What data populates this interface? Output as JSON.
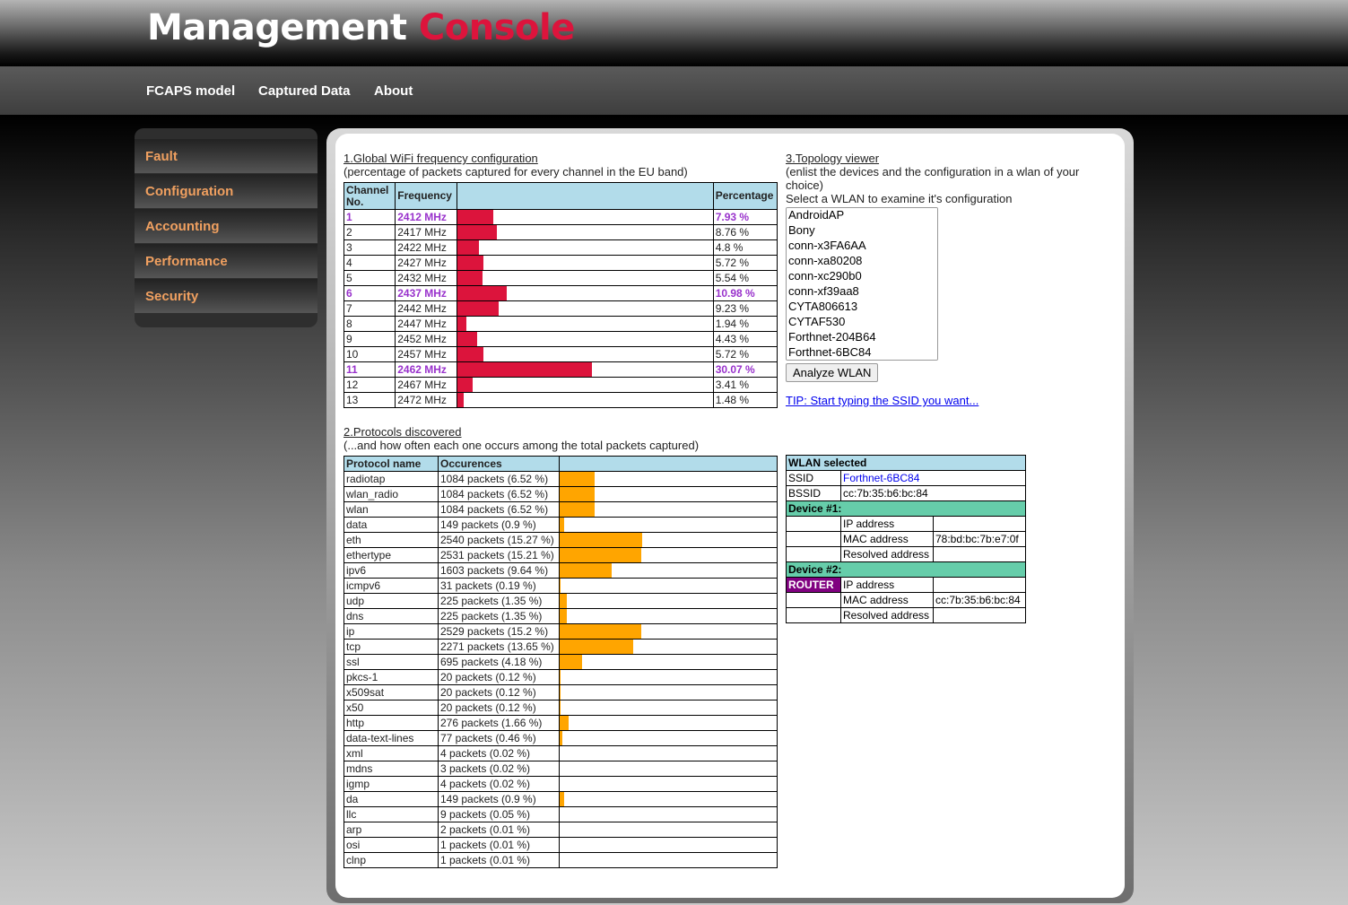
{
  "app": {
    "title_main": "Management",
    "title_accent": "Console"
  },
  "nav": [
    "FCAPS model",
    "Captured Data",
    "About"
  ],
  "sidebar": [
    "Fault",
    "Configuration",
    "Accounting",
    "Performance",
    "Security"
  ],
  "section1": {
    "heading": "1.Global WiFi frequency configuration",
    "subtitle": "(percentage of packets captured for every channel in the EU band)",
    "columns": [
      "Channel No.",
      "Frequency",
      "",
      "Percentage"
    ],
    "rows": [
      {
        "ch": "1",
        "freq": "2412 MHz",
        "pct": "7.93 %",
        "val": 7.93,
        "hl": true
      },
      {
        "ch": "2",
        "freq": "2417 MHz",
        "pct": "8.76 %",
        "val": 8.76,
        "hl": false
      },
      {
        "ch": "3",
        "freq": "2422 MHz",
        "pct": "4.8 %",
        "val": 4.8,
        "hl": false
      },
      {
        "ch": "4",
        "freq": "2427 MHz",
        "pct": "5.72 %",
        "val": 5.72,
        "hl": false
      },
      {
        "ch": "5",
        "freq": "2432 MHz",
        "pct": "5.54 %",
        "val": 5.54,
        "hl": false
      },
      {
        "ch": "6",
        "freq": "2437 MHz",
        "pct": "10.98 %",
        "val": 10.98,
        "hl": true
      },
      {
        "ch": "7",
        "freq": "2442 MHz",
        "pct": "9.23 %",
        "val": 9.23,
        "hl": false
      },
      {
        "ch": "8",
        "freq": "2447 MHz",
        "pct": "1.94 %",
        "val": 1.94,
        "hl": false
      },
      {
        "ch": "9",
        "freq": "2452 MHz",
        "pct": "4.43 %",
        "val": 4.43,
        "hl": false
      },
      {
        "ch": "10",
        "freq": "2457 MHz",
        "pct": "5.72 %",
        "val": 5.72,
        "hl": false
      },
      {
        "ch": "11",
        "freq": "2462 MHz",
        "pct": "30.07 %",
        "val": 30.07,
        "hl": true
      },
      {
        "ch": "12",
        "freq": "2467 MHz",
        "pct": "3.41 %",
        "val": 3.41,
        "hl": false
      },
      {
        "ch": "13",
        "freq": "2472 MHz",
        "pct": "1.48 %",
        "val": 1.48,
        "hl": false
      }
    ]
  },
  "section2": {
    "heading": "2.Protocols discovered",
    "subtitle": "(...and how often each one occurs among the total packets captured)",
    "columns": [
      "Protocol name",
      "Occurences",
      ""
    ],
    "rows": [
      {
        "name": "radiotap",
        "occ": "1084 packets (6.52 %)",
        "val": 6.52
      },
      {
        "name": "wlan_radio",
        "occ": "1084 packets (6.52 %)",
        "val": 6.52
      },
      {
        "name": "wlan",
        "occ": "1084 packets (6.52 %)",
        "val": 6.52
      },
      {
        "name": "data",
        "occ": "149 packets (0.9 %)",
        "val": 0.9
      },
      {
        "name": "eth",
        "occ": "2540 packets (15.27 %)",
        "val": 15.27
      },
      {
        "name": "ethertype",
        "occ": "2531 packets (15.21 %)",
        "val": 15.21
      },
      {
        "name": "ipv6",
        "occ": "1603 packets (9.64 %)",
        "val": 9.64
      },
      {
        "name": "icmpv6",
        "occ": "31 packets (0.19 %)",
        "val": 0.19
      },
      {
        "name": "udp",
        "occ": "225 packets (1.35 %)",
        "val": 1.35
      },
      {
        "name": "dns",
        "occ": "225 packets (1.35 %)",
        "val": 1.35
      },
      {
        "name": "ip",
        "occ": "2529 packets (15.2 %)",
        "val": 15.2
      },
      {
        "name": "tcp",
        "occ": "2271 packets (13.65 %)",
        "val": 13.65
      },
      {
        "name": "ssl",
        "occ": "695 packets (4.18 %)",
        "val": 4.18
      },
      {
        "name": "pkcs-1",
        "occ": "20 packets (0.12 %)",
        "val": 0.12
      },
      {
        "name": "x509sat",
        "occ": "20 packets (0.12 %)",
        "val": 0.12
      },
      {
        "name": "x50",
        "occ": "20 packets (0.12 %)",
        "val": 0.12
      },
      {
        "name": "http",
        "occ": "276 packets (1.66 %)",
        "val": 1.66
      },
      {
        "name": "data-text-lines",
        "occ": "77 packets (0.46 %)",
        "val": 0.46
      },
      {
        "name": "xml",
        "occ": "4 packets (0.02 %)",
        "val": 0.02
      },
      {
        "name": "mdns",
        "occ": "3 packets (0.02 %)",
        "val": 0.02
      },
      {
        "name": "igmp",
        "occ": "4 packets (0.02 %)",
        "val": 0.02
      },
      {
        "name": "da",
        "occ": "149 packets (0.9 %)",
        "val": 0.9
      },
      {
        "name": "llc",
        "occ": "9 packets (0.05 %)",
        "val": 0.05
      },
      {
        "name": "arp",
        "occ": "2 packets (0.01 %)",
        "val": 0.01
      },
      {
        "name": "osi",
        "occ": "1 packets (0.01 %)",
        "val": 0.01
      },
      {
        "name": "clnp",
        "occ": "1 packets (0.01 %)",
        "val": 0.01
      }
    ]
  },
  "section3": {
    "heading": "3.Topology viewer",
    "subtitle": "(enlist the devices and the configuration in a wlan of your choice)",
    "prompt": "Select a WLAN to examine it's configuration",
    "wlans": [
      "AndroidAP",
      "Bony",
      "conn-x3FA6AA",
      "conn-xa80208",
      "conn-xc290b0",
      "conn-xf39aa8",
      "CYTA806613",
      "CYTAF530",
      "Forthnet-204B64",
      "Forthnet-6BC84"
    ],
    "button": "Analyze WLAN",
    "tip": "TIP: Start typing the SSID you want..."
  },
  "wlan_selected": {
    "header": "WLAN selected",
    "ssid_label": "SSID",
    "ssid": "Forthnet-6BC84",
    "bssid_label": "BSSID",
    "bssid": "cc:7b:35:b6:bc:84",
    "devices": [
      {
        "title": "Device #1:",
        "badge": "",
        "ip_label": "IP address",
        "ip": "",
        "mac_label": "MAC address",
        "mac": "78:bd:bc:7b:e7:0f",
        "res_label": "Resolved address",
        "res": ""
      },
      {
        "title": "Device #2:",
        "badge": "ROUTER",
        "ip_label": "IP address",
        "ip": "",
        "mac_label": "MAC address",
        "mac": "cc:7b:35:b6:bc:84",
        "res_label": "Resolved address",
        "res": ""
      }
    ]
  },
  "colors": {
    "freq_bar": "#dc143c",
    "proto_bar": "#ffa500",
    "highlight": "#9932cc",
    "header_bg": "#b2dcea",
    "device_bg": "#66cdaa",
    "router_bg": "#800080"
  }
}
